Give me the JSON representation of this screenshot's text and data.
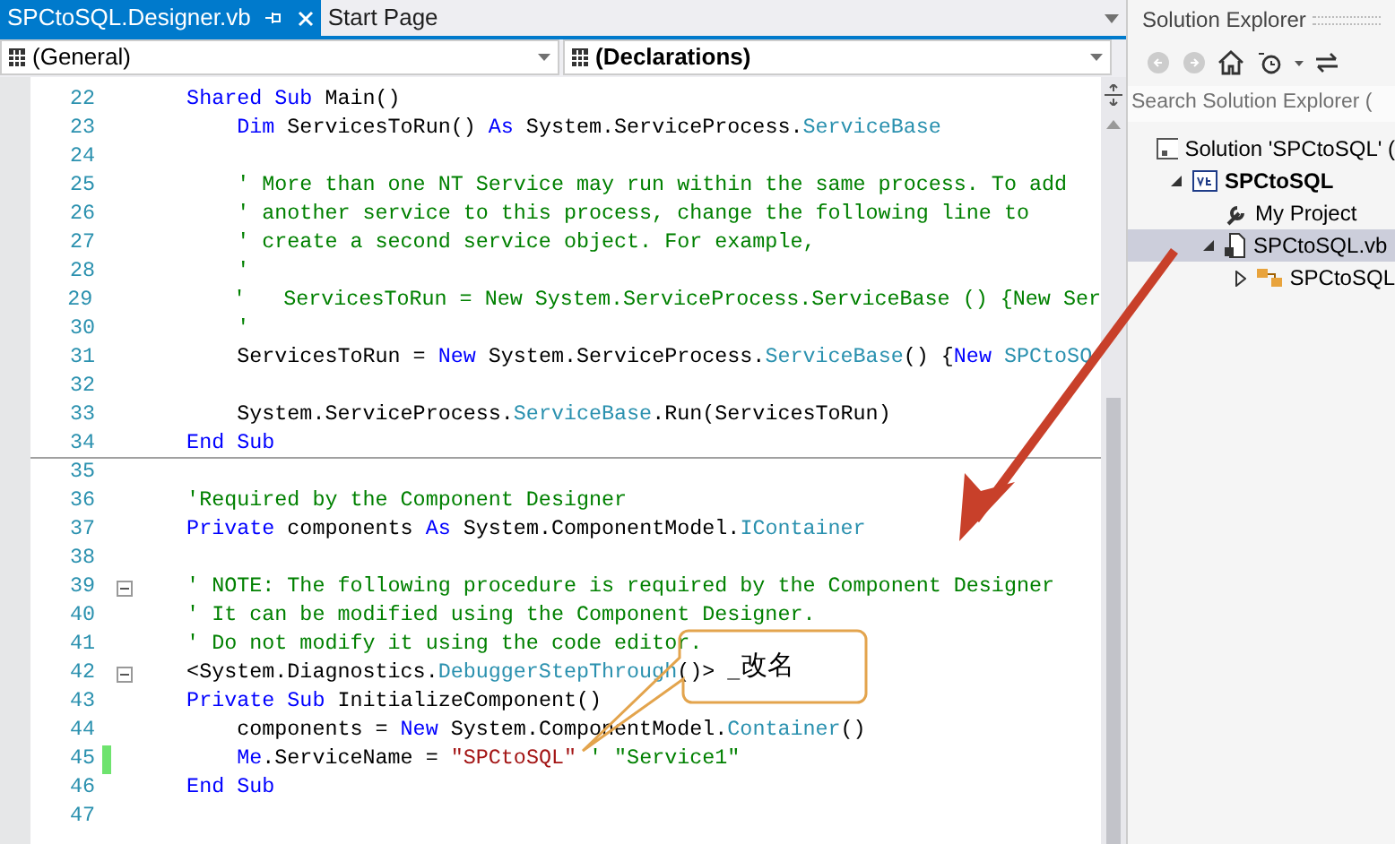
{
  "editor": {
    "tabs": [
      {
        "label": "SPCtoSQL.Designer.vb",
        "selected": true
      },
      {
        "label": "Start Page",
        "selected": false
      }
    ],
    "dropdowns": [
      "(General)",
      "(Declarations)"
    ],
    "lines": [
      {
        "number": "22",
        "foldable": false,
        "changed": false,
        "separator_below": false,
        "segments": [
          {
            "text": "    Shared Sub",
            "kind": "keyword"
          },
          {
            "text": " Main()"
          }
        ]
      },
      {
        "number": "23",
        "foldable": false,
        "changed": false,
        "separator_below": false,
        "segments": [
          {
            "text": "        Dim",
            "kind": "keyword"
          },
          {
            "text": " ServicesToRun() "
          },
          {
            "text": "As",
            "kind": "keyword"
          },
          {
            "text": " System.ServiceProcess."
          },
          {
            "text": "ServiceBase",
            "kind": "type"
          }
        ]
      },
      {
        "number": "24",
        "foldable": false,
        "changed": false,
        "separator_below": false
      },
      {
        "number": "25",
        "foldable": false,
        "changed": false,
        "separator_below": false,
        "segments": [
          {
            "text": "        ' More than one NT Service may run within the same process. To add",
            "kind": "comment"
          }
        ]
      },
      {
        "number": "26",
        "foldable": false,
        "changed": false,
        "separator_below": false,
        "segments": [
          {
            "text": "        ' another service to this process, change the following line to",
            "kind": "comment"
          }
        ]
      },
      {
        "number": "27",
        "foldable": false,
        "changed": false,
        "separator_below": false,
        "segments": [
          {
            "text": "        ' create a second service object. For example,",
            "kind": "comment"
          }
        ]
      },
      {
        "number": "28",
        "foldable": false,
        "changed": false,
        "separator_below": false,
        "segments": [
          {
            "text": "        '",
            "kind": "comment"
          }
        ]
      },
      {
        "number": "29",
        "foldable": false,
        "changed": false,
        "separator_below": false,
        "segments": [
          {
            "text": "        '   ServicesToRun = New System.ServiceProcess.ServiceBase () {New Ser",
            "kind": "comment"
          }
        ]
      },
      {
        "number": "30",
        "foldable": false,
        "changed": false,
        "separator_below": false,
        "segments": [
          {
            "text": "        '",
            "kind": "comment"
          }
        ]
      },
      {
        "number": "31",
        "foldable": false,
        "changed": false,
        "separator_below": false,
        "segments": [
          {
            "text": "        ServicesToRun = "
          },
          {
            "text": "New",
            "kind": "keyword"
          },
          {
            "text": " System.ServiceProcess."
          },
          {
            "text": "ServiceBase",
            "kind": "type"
          },
          {
            "text": "() {"
          },
          {
            "text": "New ",
            "kind": "keyword"
          },
          {
            "text": "SPCtoSQ",
            "kind": "type"
          }
        ]
      },
      {
        "number": "32",
        "foldable": false,
        "changed": false,
        "separator_below": false
      },
      {
        "number": "33",
        "foldable": false,
        "changed": false,
        "separator_below": false,
        "segments": [
          {
            "text": "        System.ServiceProcess."
          },
          {
            "text": "ServiceBase",
            "kind": "type"
          },
          {
            "text": ".Run(ServicesToRun)"
          }
        ]
      },
      {
        "number": "34",
        "foldable": false,
        "changed": false,
        "separator_below": true,
        "segments": [
          {
            "text": "    End Sub",
            "kind": "keyword"
          }
        ]
      },
      {
        "number": "35",
        "foldable": false,
        "changed": false,
        "separator_below": false
      },
      {
        "number": "36",
        "foldable": false,
        "changed": false,
        "separator_below": false,
        "segments": [
          {
            "text": "    'Required by the Component Designer",
            "kind": "comment"
          }
        ]
      },
      {
        "number": "37",
        "foldable": false,
        "changed": false,
        "separator_below": false,
        "segments": [
          {
            "text": "    Private",
            "kind": "keyword"
          },
          {
            "text": " components "
          },
          {
            "text": "As",
            "kind": "keyword"
          },
          {
            "text": " System.ComponentModel."
          },
          {
            "text": "IContainer",
            "kind": "type"
          }
        ]
      },
      {
        "number": "38",
        "foldable": false,
        "changed": false,
        "separator_below": false
      },
      {
        "number": "39",
        "foldable": true,
        "changed": false,
        "separator_below": false,
        "segments": [
          {
            "text": "    ' NOTE: The following procedure is required by the Component Designer",
            "kind": "comment"
          }
        ]
      },
      {
        "number": "40",
        "foldable": false,
        "changed": false,
        "separator_below": false,
        "segments": [
          {
            "text": "    ' It can be modified using the Component Designer.",
            "kind": "comment"
          }
        ]
      },
      {
        "number": "41",
        "foldable": false,
        "changed": false,
        "separator_below": false,
        "segments": [
          {
            "text": "    ' Do not modify it using the code editor.",
            "kind": "comment"
          }
        ]
      },
      {
        "number": "42",
        "foldable": true,
        "changed": false,
        "separator_below": false,
        "segments": [
          {
            "text": "    <System.Diagnostics."
          },
          {
            "text": "DebuggerStepThrough",
            "kind": "type"
          },
          {
            "text": "()> _"
          }
        ]
      },
      {
        "number": "43",
        "foldable": false,
        "changed": false,
        "separator_below": false,
        "segments": [
          {
            "text": "    Private Sub",
            "kind": "keyword"
          },
          {
            "text": " InitializeComponent()"
          }
        ]
      },
      {
        "number": "44",
        "foldable": false,
        "changed": false,
        "separator_below": false,
        "segments": [
          {
            "text": "        components = "
          },
          {
            "text": "New",
            "kind": "keyword"
          },
          {
            "text": " System.ComponentModel."
          },
          {
            "text": "Container",
            "kind": "type"
          },
          {
            "text": "()"
          }
        ]
      },
      {
        "number": "45",
        "foldable": false,
        "changed": true,
        "separator_below": false,
        "segments": [
          {
            "text": "        Me",
            "kind": "keyword"
          },
          {
            "text": ".ServiceName = "
          },
          {
            "text": "\"SPCtoSQL\"",
            "kind": "string"
          },
          {
            "text": " ' \"Service1\"",
            "kind": "comment"
          }
        ]
      },
      {
        "number": "46",
        "foldable": false,
        "changed": false,
        "separator_below": false,
        "segments": [
          {
            "text": "    End Sub",
            "kind": "keyword"
          }
        ]
      },
      {
        "number": "47",
        "foldable": false,
        "changed": false,
        "separator_below": false
      }
    ]
  },
  "callout": {
    "text": "改名"
  },
  "solution_explorer": {
    "title": "Solution Explorer",
    "search": {
      "placeholder": "Search Solution Explorer ("
    },
    "tree": [
      {
        "label": "Solution 'SPCtoSQL' (",
        "kind": "solution",
        "selected": false,
        "children": [
          {
            "label": "SPCtoSQL",
            "kind": "project",
            "expanded": true,
            "selected": false,
            "children": [
              {
                "label": "My Project",
                "kind": "settings",
                "selected": false
              },
              {
                "label": "SPCtoSQL.vb",
                "kind": "file",
                "expanded": true,
                "selected": true,
                "children": [
                  {
                    "label": "SPCtoSQL",
                    "kind": "class",
                    "expanded": false,
                    "selected": false
                  }
                ]
              }
            ]
          }
        ]
      }
    ]
  }
}
